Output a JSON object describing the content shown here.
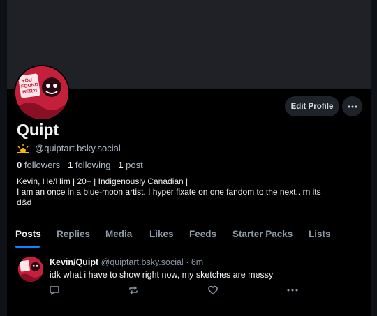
{
  "colors": {
    "accent": "#1083fe",
    "background": "#000000",
    "banner": "#1f2126",
    "muted": "#8d9aa8"
  },
  "avatar": {
    "text": "YOU FOUND HER?!",
    "icon": "avatar-illustration"
  },
  "profile": {
    "display_name": "Quipt",
    "handle_icon": "sun-emoji",
    "handle": "@quiptart.bsky.social",
    "followers_count": "0",
    "followers_label": "followers",
    "following_count": "1",
    "following_label": "following",
    "posts_count": "1",
    "posts_label": "post",
    "bio_line1": "Kevin, He/Him | 20+ | Indigenously Canadian |",
    "bio_line2": "I am an once in a blue-moon artist. I hyper fixate on one fandom to the next.. rn its",
    "bio_line3": "d&d"
  },
  "actions": {
    "edit_profile": "Edit Profile",
    "more_icon": "ellipsis-icon"
  },
  "tabs": [
    {
      "label": "Posts",
      "active": true
    },
    {
      "label": "Replies",
      "active": false
    },
    {
      "label": "Media",
      "active": false
    },
    {
      "label": "Likes",
      "active": false
    },
    {
      "label": "Feeds",
      "active": false
    },
    {
      "label": "Starter Packs",
      "active": false
    },
    {
      "label": "Lists",
      "active": false
    }
  ],
  "post": {
    "author": "Kevin/Quipt",
    "handle": "@quiptart.bsky.social",
    "separator": "·",
    "time": "6m",
    "text": "idk what i have to show right now, my sketches are messy",
    "action_icons": [
      "reply-icon",
      "repost-icon",
      "like-icon",
      "post-menu-icon"
    ]
  }
}
